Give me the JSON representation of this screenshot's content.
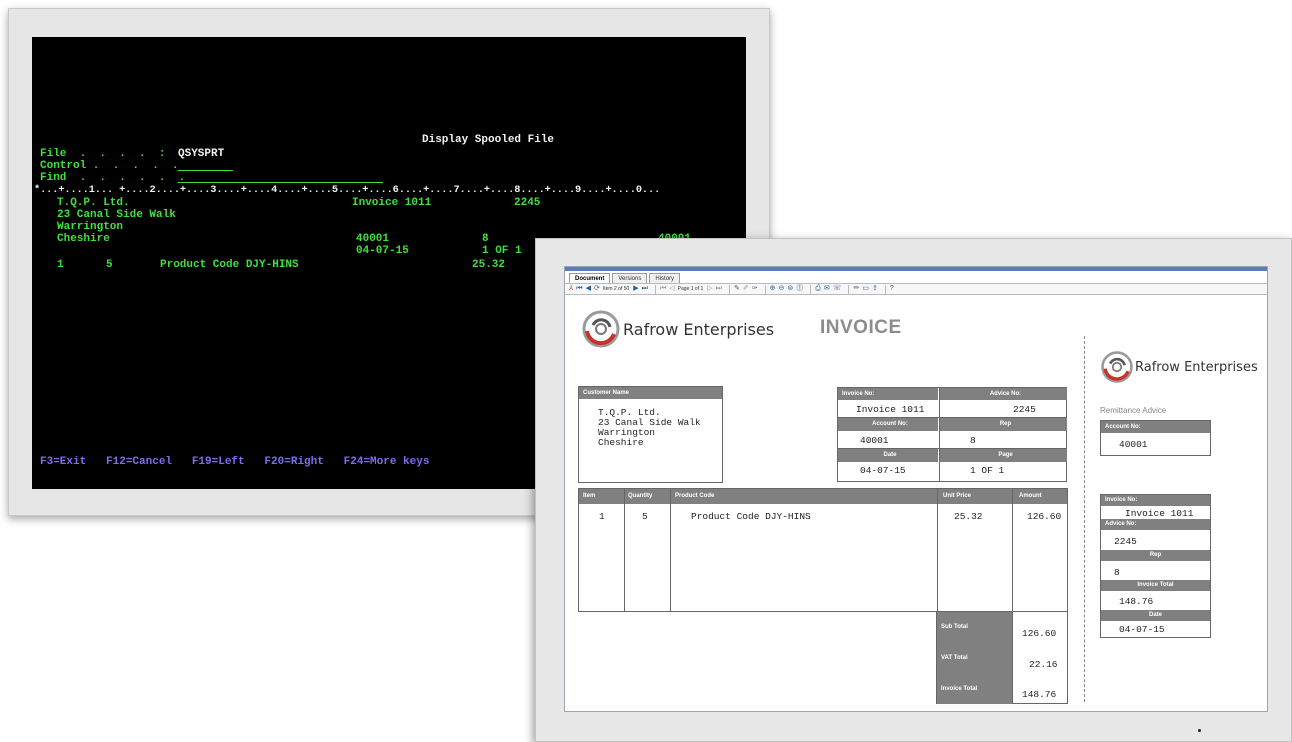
{
  "terminal": {
    "title": "Display Spooled File",
    "file_label": "File  .  .  .  .  :",
    "file_value": "QSYSPRT",
    "control_label": "Control .  .  .  .  .",
    "find_label": "Find  .  .  .  .  .  .",
    "ruler": "*...+....1... +....2....+....3....+....4....+....5....+....6....+....7....+....8....+....9....+....0...",
    "lines": {
      "customer_name": "T.Q.P. Ltd.",
      "address1": "23 Canal Side Walk",
      "address2": "Warrington",
      "address3": "Cheshire",
      "invoice": "Invoice 1011",
      "advice": "2245",
      "account": "40001",
      "rep": "8",
      "remit_account": "40001",
      "date": "04-07-15",
      "page": "1 OF 1",
      "item": "1",
      "quantity": "5",
      "product": "Product Code DJY-HINS",
      "unit_price": "25.32"
    },
    "function_keys": "F3=Exit   F12=Cancel   F19=Left   F20=Right   F24=More keys"
  },
  "viewer": {
    "tabs": [
      "Document",
      "Versions",
      "History"
    ],
    "toolbar": {
      "item_text": "Item 2 of 50",
      "page_text": "Page 1 of 1"
    },
    "company": "Rafrow Enterprises",
    "heading": "INVOICE",
    "customer": {
      "header": "Customer Name",
      "lines": [
        "T.Q.P. Ltd.",
        "23 Canal Side Walk",
        "Warrington",
        "Cheshire"
      ]
    },
    "invoice_info": {
      "invoice_no_label": "Invoice No:",
      "invoice_no": "Invoice 1011",
      "advice_no_label": "Advice No:",
      "advice_no": "2245",
      "account_no_label": "Account No:",
      "account_no": "40001",
      "rep_label": "Rep",
      "rep": "8",
      "date_label": "Date",
      "date": "04-07-15",
      "page_label": "Page",
      "page": "1 OF 1"
    },
    "table": {
      "headers": [
        "Item",
        "Quantity",
        "Product Code",
        "Unit Price",
        "Amount"
      ],
      "rows": [
        {
          "item": "1",
          "quantity": "5",
          "product": "Product Code DJY-HINS",
          "unit_price": "25.32",
          "amount": "126.60"
        }
      ],
      "sub_total_label": "Sub Total",
      "sub_total": "126.60",
      "vat_label": "VAT Total",
      "vat": "22.16",
      "invoice_total_label": "Invoice Total",
      "invoice_total": "148.76"
    },
    "remittance": {
      "title": "Remittance Advice",
      "account_no_label": "Account No:",
      "account_no": "40001",
      "invoice_no_label": "Invoice No:",
      "invoice_no": "Invoice 1011",
      "advice_no_label": "Advice No:",
      "advice_no": "2245",
      "rep_label": "Rep",
      "rep": "8",
      "invoice_total_label": "Invoice Total",
      "invoice_total": "148.76",
      "date_label": "Date",
      "date": "04-07-15"
    }
  }
}
